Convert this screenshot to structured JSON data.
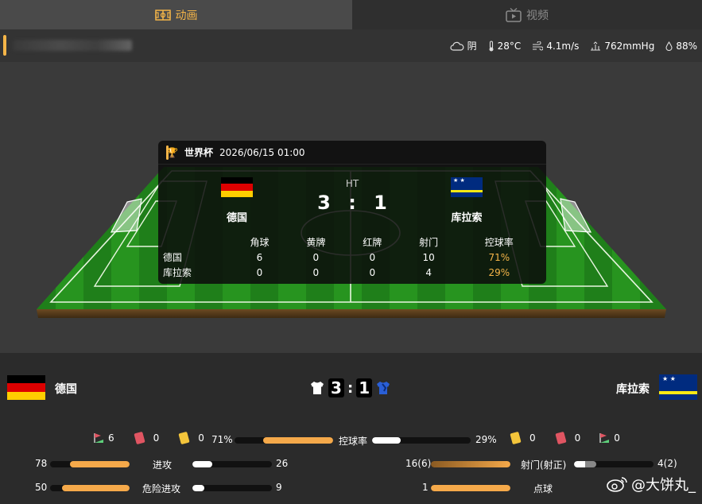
{
  "tabs": [
    {
      "label": "动画",
      "active": true
    },
    {
      "label": "视频",
      "active": false
    }
  ],
  "weather": {
    "condition": "阴",
    "temperature": "28°C",
    "wind": "4.1m/s",
    "pressure": "762mmHg",
    "humidity": "88%"
  },
  "match": {
    "league": "世界杯",
    "datetime": "2026/06/15 01:00",
    "status": "HT",
    "home": {
      "name": "德国",
      "score": "3"
    },
    "away": {
      "name": "库拉索",
      "score": "1"
    },
    "score_sep": ":"
  },
  "popup_table": {
    "headers": [
      "",
      "角球",
      "黄牌",
      "红牌",
      "射门",
      "控球率"
    ],
    "rows": [
      [
        "德国",
        "6",
        "0",
        "0",
        "10",
        "71%"
      ],
      [
        "库拉索",
        "0",
        "0",
        "0",
        "4",
        "29%"
      ]
    ]
  },
  "events": {
    "home": {
      "corners": "6",
      "red": "0",
      "yellow": "0"
    },
    "away": {
      "yellow": "0",
      "red": "0",
      "corners": "0"
    }
  },
  "stats": {
    "possession": {
      "label": "控球率",
      "home": "71%",
      "away": "29%",
      "home_frac": 0.71,
      "away_frac": 0.29
    },
    "attacks": {
      "label": "进攻",
      "home": "78",
      "away": "26"
    },
    "dangerous": {
      "label": "危险进攻",
      "home": "50",
      "away": "9"
    },
    "shots": {
      "label": "射门(射正)",
      "home": "16(6)",
      "away": "4(2)"
    },
    "penalties": {
      "label": "点球",
      "home": "1",
      "away": ""
    }
  },
  "watermark": "@大饼丸_",
  "colors": {
    "accent": "#f5b548",
    "bar_orange": "#f5a94a",
    "pitch_green": "#1f8a1f"
  }
}
